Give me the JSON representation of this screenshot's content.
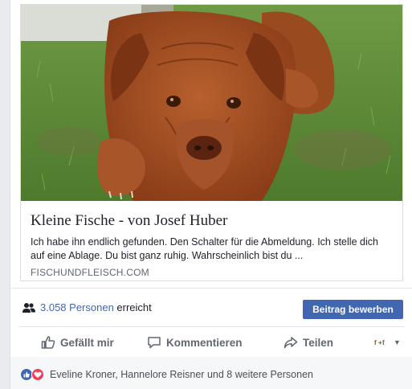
{
  "link_preview": {
    "title": "Kleine Fische - von Josef Huber",
    "description": "Ich habe ihn endlich gefunden. Den Schalter für die Abmeldung. Ich stelle dich auf eine Ablage. Du bist ganz ruhig. Wahrscheinlich bist du ...",
    "domain": "FISCHUNDFLEISCH.COM",
    "image": "dogue-de-bordeaux-dog-lying-on-grass"
  },
  "reach": {
    "count_text": "3.058 Personen",
    "suffix_text": " erreicht",
    "icon": "people-icon",
    "boost_button_label": "Beitrag bewerben"
  },
  "actions": {
    "like_label": "Gefällt mir",
    "comment_label": "Kommentieren",
    "share_label": "Teilen"
  },
  "reactions": {
    "types": [
      "like",
      "love"
    ],
    "names_text": "Eveline Kroner, Hannelore Reisner und 8 weitere Personen"
  },
  "colors": {
    "accent": "#4267b2",
    "background": "#e9ebee",
    "muted_text": "#606770"
  }
}
